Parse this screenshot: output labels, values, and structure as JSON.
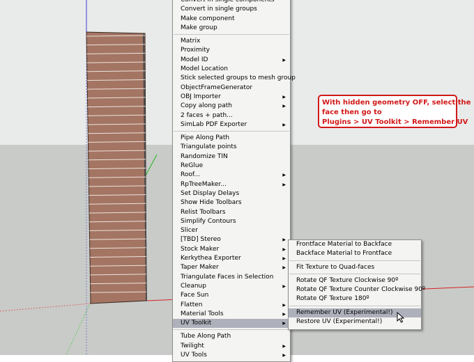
{
  "main_menu": {
    "groups": [
      [
        "Convert in single components",
        "Convert in single groups",
        "Make component",
        "Make group"
      ],
      [
        "Matrix",
        "Proximity",
        "Model ID",
        "Model Location",
        "Stick selected groups to mesh group",
        "ObjectFrameGenerator",
        "OBJ Importer",
        "Copy along path",
        "2 faces + path...",
        "SimLab PDF Exporter"
      ],
      [
        "Pipe Along Path",
        "Triangulate points",
        "Randomize TIN",
        "ReGlue",
        "Roof...",
        "RpTreeMaker...",
        "Set Display Delays",
        "Show Hide Toolbars",
        "Relist Toolbars",
        "Simplify Contours",
        "Slicer",
        "[TBD] Stereo",
        "Stock Maker",
        "Kerkythea Exporter",
        "Taper Maker",
        "Triangulate Faces in Selection",
        "Cleanup",
        "Face Sun",
        "Flatten",
        "Material Tools",
        "UV Toolkit"
      ],
      [
        "Tube Along Path",
        "Twilight",
        "UV Tools"
      ]
    ],
    "submenu_items": [
      "Model ID",
      "OBJ Importer",
      "Copy along path",
      "SimLab PDF Exporter",
      "Roof...",
      "RpTreeMaker...",
      "[TBD] Stereo",
      "Stock Maker",
      "Kerkythea Exporter",
      "Taper Maker",
      "Cleanup",
      "Flatten",
      "Material Tools",
      "UV Toolkit",
      "Twilight",
      "UV Tools"
    ],
    "highlighted": "UV Toolkit"
  },
  "submenu": {
    "groups": [
      [
        "Frontface Material to Backface",
        "Backface Material to Frontface"
      ],
      [
        "Fit Texture to Quad-faces"
      ],
      [
        "Rotate QF Texture Clockwise 90º",
        "Rotate QF Texture Counter Clockwise 90º",
        "Rotate QF Texture 180º"
      ],
      [
        "Remember UV (Experimental!)",
        "Restore UV (Experimental!)"
      ]
    ],
    "highlighted": "Remember UV (Experimental!)"
  },
  "annotation": {
    "line1": "With hidden geometry OFF, select the",
    "line2": "face then go to",
    "line3": "Plugins > UV Toolkit > Remember UV"
  },
  "colors": {
    "sky": "#e9eaea",
    "ground": "#c9cbc8",
    "tower_brick": "#a47563",
    "menu_bg": "#f4f4f2",
    "menu_highlight": "#aeb0bb",
    "annotation_red": "#d21818",
    "axis_blue": "#3c3cd2",
    "axis_red": "#d22323",
    "axis_green": "#23b423"
  },
  "icons": [
    "submenu-arrow-icon",
    "mouse-pointer-icon"
  ]
}
